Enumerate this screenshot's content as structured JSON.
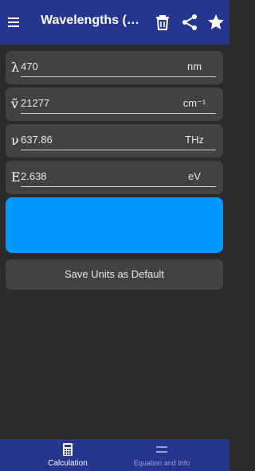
{
  "appbar": {
    "title": "Wavelengths (λ/ṽ/…",
    "icons": [
      "menu-icon",
      "trash-icon",
      "share-icon",
      "star-icon"
    ]
  },
  "rows": [
    {
      "symbol": "λ",
      "value": "470",
      "unit": "nm"
    },
    {
      "symbol": "ṽ",
      "value": "21277",
      "unit": "cm⁻¹"
    },
    {
      "symbol": "ν",
      "value": "637.86",
      "unit": "THz"
    },
    {
      "symbol": "E",
      "value": "2.638",
      "unit": "eV"
    }
  ],
  "swatch": {
    "color": "#009aff"
  },
  "save_button": {
    "label": "Save Units as Default"
  },
  "bottom_nav": {
    "items": [
      {
        "label": "Calculation",
        "icon": "calculator-icon",
        "active": true
      },
      {
        "label": "Equation and Info",
        "icon": "equals-icon",
        "active": false
      }
    ]
  },
  "colors": {
    "primary": "#253590",
    "background": "#2b2b2b",
    "card": "#424242"
  }
}
